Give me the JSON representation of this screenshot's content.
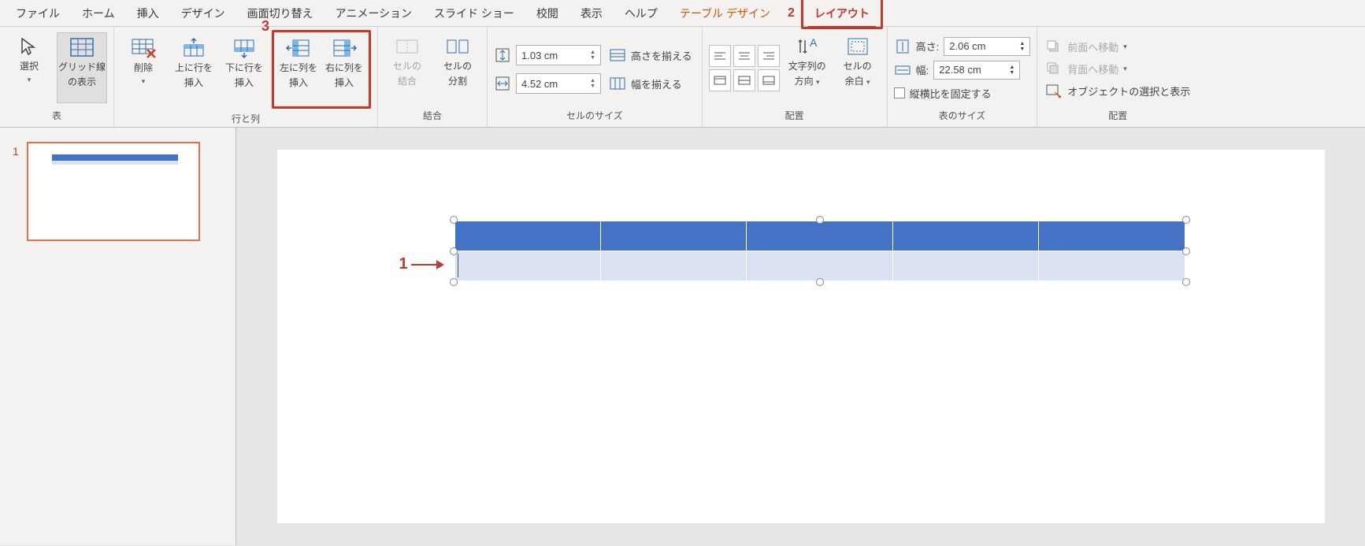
{
  "tabs": {
    "file": "ファイル",
    "home": "ホーム",
    "insert": "挿入",
    "design": "デザイン",
    "transition": "画面切り替え",
    "animation": "アニメーション",
    "slideshow": "スライド ショー",
    "review": "校閲",
    "view": "表示",
    "help": "ヘルプ",
    "table_design": "テーブル デザイン",
    "layout": "レイアウト"
  },
  "callouts": {
    "c1": "1",
    "c2": "2",
    "c3": "3"
  },
  "grp_table": {
    "label": "表",
    "select": "選択",
    "gridlines_l1": "グリッド線",
    "gridlines_l2": "の表示"
  },
  "grp_rows": {
    "label": "行と列",
    "delete": "削除",
    "row_above_l1": "上に行を",
    "row_above_l2": "挿入",
    "row_below_l1": "下に行を",
    "row_below_l2": "挿入",
    "col_left_l1": "左に列を",
    "col_left_l2": "挿入",
    "col_right_l1": "右に列を",
    "col_right_l2": "挿入"
  },
  "grp_merge": {
    "label": "結合",
    "merge_l1": "セルの",
    "merge_l2": "結合",
    "split_l1": "セルの",
    "split_l2": "分割"
  },
  "grp_cellsize": {
    "label": "セルのサイズ",
    "height": "1.03 cm",
    "width": "4.52 cm",
    "dist_rows": "高さを揃える",
    "dist_cols": "幅を揃える"
  },
  "grp_align": {
    "label": "配置",
    "text_dir_l1": "文字列の",
    "text_dir_l2": "方向",
    "margins_l1": "セルの",
    "margins_l2": "余白"
  },
  "grp_tsize": {
    "label": "表のサイズ",
    "h_label": "高さ:",
    "h_val": "2.06 cm",
    "w_label": "幅:",
    "w_val": "22.58 cm",
    "lock": "縦横比を固定する"
  },
  "grp_arrange": {
    "label": "配置",
    "front": "前面へ移動",
    "back": "背面へ移動",
    "select_pane": "オブジェクトの選択と表示"
  },
  "thumb": {
    "num": "1"
  }
}
